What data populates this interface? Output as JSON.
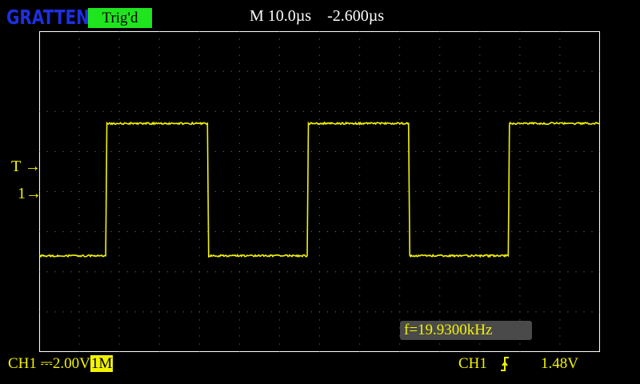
{
  "header": {
    "brand": "GRATTEN",
    "trigger_status": "Trig'd",
    "timebase": "M 10.0µs",
    "horizontal_position": "-2.600µs"
  },
  "markers": {
    "trigger_level": "T",
    "channel1": "1"
  },
  "measurement": {
    "frequency": "f=19.9300kHz"
  },
  "footer": {
    "channel": "CH1",
    "coupling_symbol": "⎓",
    "volts_per_div": "2.00V",
    "impedance": "1M",
    "trigger_source": "CH1",
    "trigger_level": "1.48V"
  },
  "colors": {
    "trace": "#f2f205",
    "grid": "#7a7a7a",
    "trig_badge": "#1fe51f",
    "brand": "#1f2fe0"
  },
  "chart_data": {
    "type": "line",
    "grid": true,
    "divisions": {
      "horizontal": 14,
      "vertical": 8
    },
    "time_per_div_us": 10.0,
    "volts_per_div": 2.0,
    "signal": "square",
    "series": [
      {
        "x": [
          0,
          16.6,
          16.9,
          42.0,
          42.3,
          66.9,
          67.2,
          92.2,
          92.5,
          117.1,
          117.4,
          140.0
        ],
        "y": [
          -3.2,
          -3.2,
          3.4,
          3.4,
          -3.2,
          -3.2,
          3.4,
          3.4,
          -3.2,
          -3.2,
          3.4,
          3.4
        ]
      }
    ]
  }
}
